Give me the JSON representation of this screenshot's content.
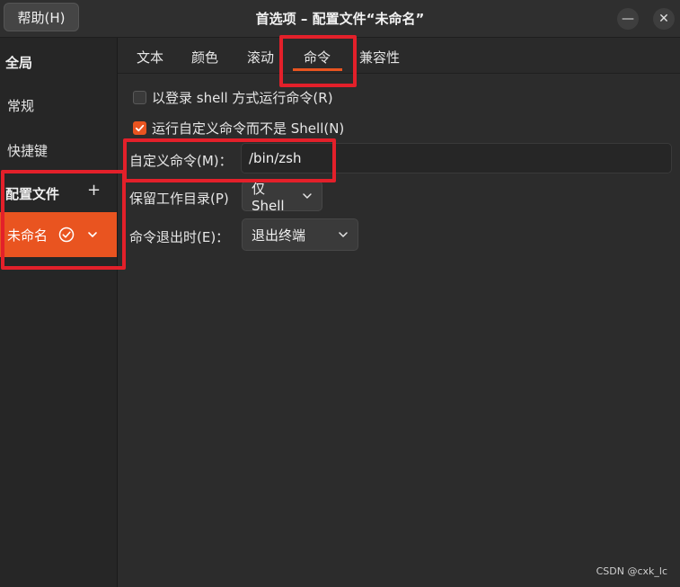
{
  "titlebar": {
    "help_label": "帮助(H)",
    "title": "首选项 – 配置文件“未命名”",
    "minimize_glyph": "—",
    "close_glyph": "✕"
  },
  "sidebar": {
    "global_heading": "全局",
    "items": [
      {
        "label": "常规"
      },
      {
        "label": "快捷键"
      }
    ],
    "profiles_heading": "配置文件",
    "add_glyph": "+",
    "profile": {
      "name": "未命名"
    }
  },
  "tabs": [
    {
      "label": "文本"
    },
    {
      "label": "颜色"
    },
    {
      "label": "滚动"
    },
    {
      "label": "命令",
      "active": true
    },
    {
      "label": "兼容性"
    }
  ],
  "command": {
    "login_shell": {
      "label": "以登录 shell 方式运行命令(R)",
      "checked": false
    },
    "custom_command_toggle": {
      "label": "运行自定义命令而不是 Shell(N)",
      "checked": true
    },
    "custom_command": {
      "label": "自定义命令(M)：",
      "value": "/bin/zsh"
    },
    "preserve_dir": {
      "label": "保留工作目录(P)",
      "value": "仅 Shell"
    },
    "on_exit": {
      "label": "命令退出时(E)：",
      "value": "退出终端"
    }
  },
  "colors": {
    "accent": "#e95420",
    "annotation": "#e3202a"
  },
  "watermark": "CSDN @cxk_lc"
}
